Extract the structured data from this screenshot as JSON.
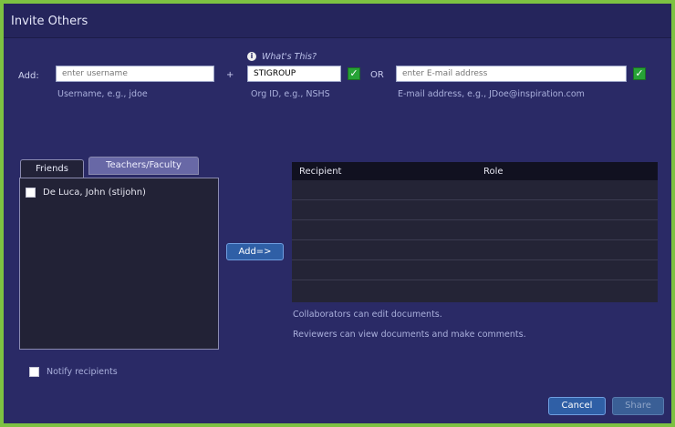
{
  "dialog": {
    "title": "Invite Others"
  },
  "add": {
    "label": "Add:",
    "username_placeholder": "enter username",
    "username_value": "",
    "username_help": "Username, e.g., jdoe",
    "plus": "+",
    "whats_this": "What's This?",
    "org_value": "STIGROUP",
    "org_help": "Org ID, e.g., NSHS",
    "or": "OR",
    "email_placeholder": "enter E-mail address",
    "email_value": "",
    "email_help": "E-mail address, e.g., JDoe@inspiration.com",
    "check_glyph": "✓",
    "info_glyph": "i"
  },
  "tabs": [
    {
      "label": "Friends",
      "active": true
    },
    {
      "label": "Teachers/Faculty",
      "active": false
    }
  ],
  "friends": [
    {
      "label": "De Luca, John (stijohn)",
      "checked": false
    }
  ],
  "add_button": {
    "label": "Add=>"
  },
  "recipients_table": {
    "headers": [
      "Recipient",
      "Role"
    ],
    "rows": []
  },
  "notes": {
    "collaborators": "Collaborators can edit documents.",
    "reviewers": "Reviewers can view documents and make comments."
  },
  "notify": {
    "label": "Notify recipients",
    "checked": false
  },
  "footer": {
    "cancel_label": "Cancel",
    "share_label": "Share"
  },
  "colors": {
    "frame_border": "#7dc242",
    "background": "#2a2a66",
    "button_primary": "#2f5fa6",
    "check_green": "#27a336"
  },
  "icons": {
    "info": "info-icon",
    "check": "check-icon"
  }
}
